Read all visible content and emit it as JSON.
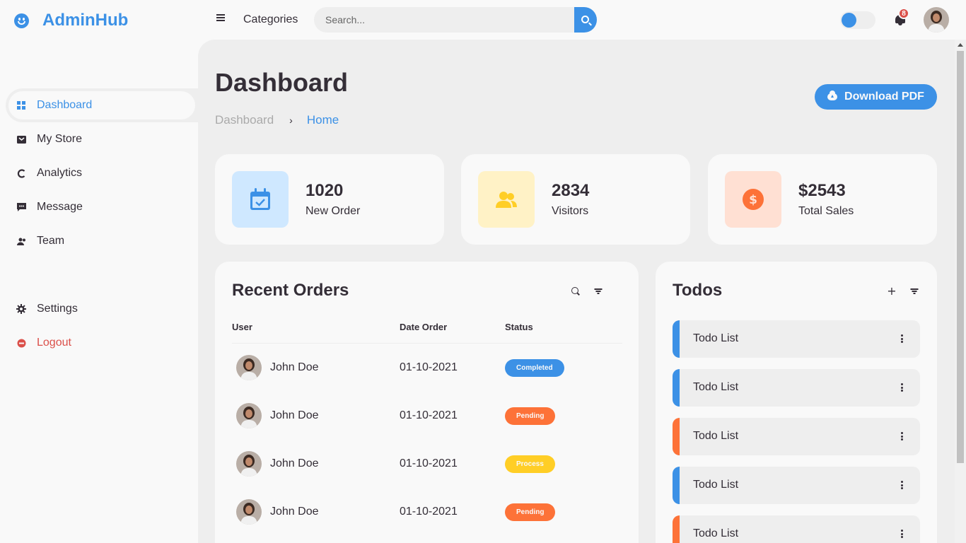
{
  "brand": {
    "name": "AdminHub"
  },
  "sidebar": {
    "items": [
      {
        "label": "Dashboard",
        "icon": "dashboard-icon",
        "active": true
      },
      {
        "label": "My Store",
        "icon": "store-icon"
      },
      {
        "label": "Analytics",
        "icon": "analytics-icon"
      },
      {
        "label": "Message",
        "icon": "message-icon"
      },
      {
        "label": "Team",
        "icon": "team-icon"
      }
    ],
    "bottom": [
      {
        "label": "Settings",
        "icon": "gear-icon"
      },
      {
        "label": "Logout",
        "icon": "logout-icon"
      }
    ]
  },
  "navbar": {
    "categories": "Categories",
    "search_placeholder": "Search...",
    "notification_count": "8"
  },
  "main": {
    "title": "Dashboard",
    "breadcrumb": [
      "Dashboard",
      "Home"
    ],
    "download_label": "Download PDF"
  },
  "stats": [
    {
      "value": "1020",
      "label": "New Order",
      "bg": "#cfe8ff",
      "fg": "#3c91e6"
    },
    {
      "value": "2834",
      "label": "Visitors",
      "bg": "#fff2c6",
      "fg": "#ffce26"
    },
    {
      "value": "$2543",
      "label": "Total Sales",
      "bg": "#ffe0d3",
      "fg": "#fd7238"
    }
  ],
  "orders": {
    "title": "Recent Orders",
    "columns": [
      "User",
      "Date Order",
      "Status"
    ],
    "rows": [
      {
        "user": "John Doe",
        "date": "01-10-2021",
        "status": "Completed",
        "color": "#3c91e6"
      },
      {
        "user": "John Doe",
        "date": "01-10-2021",
        "status": "Pending",
        "color": "#fd7238"
      },
      {
        "user": "John Doe",
        "date": "01-10-2021",
        "status": "Process",
        "color": "#ffce26"
      },
      {
        "user": "John Doe",
        "date": "01-10-2021",
        "status": "Pending",
        "color": "#fd7238"
      }
    ]
  },
  "todos": {
    "title": "Todos",
    "items": [
      {
        "label": "Todo List",
        "color": "#3c91e6"
      },
      {
        "label": "Todo List",
        "color": "#3c91e6"
      },
      {
        "label": "Todo List",
        "color": "#fd7238"
      },
      {
        "label": "Todo List",
        "color": "#3c91e6"
      },
      {
        "label": "Todo List",
        "color": "#fd7238"
      }
    ]
  },
  "colors": {
    "accent": "#3c91e6",
    "danger": "#db504a",
    "bg": "#eeeeee",
    "card": "#f9f9f9"
  }
}
